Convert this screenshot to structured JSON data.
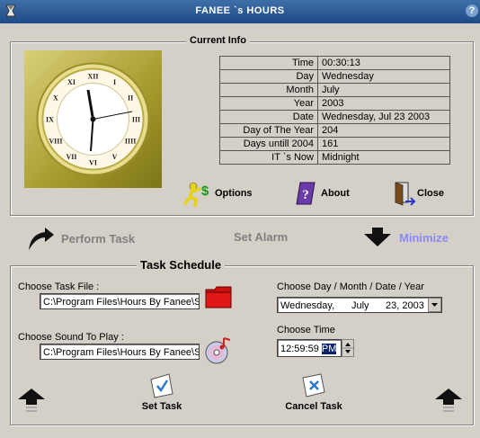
{
  "window": {
    "title": "FANEE `s HOURS",
    "help_label": "?"
  },
  "current_info": {
    "legend": "Current Info",
    "rows": [
      {
        "label": "Time",
        "value": "00:30:13"
      },
      {
        "label": "Day",
        "value": "Wednesday"
      },
      {
        "label": "Month",
        "value": "July"
      },
      {
        "label": "Year",
        "value": "2003"
      },
      {
        "label": "Date",
        "value": "Wednesday, Jul 23 2003"
      },
      {
        "label": "Day of The Year",
        "value": "204"
      },
      {
        "label": "Days untill  2004",
        "value": "161"
      },
      {
        "label": "IT `s Now",
        "value": "Midnight"
      }
    ],
    "clock_numerals": [
      "XII",
      "I",
      "II",
      "III",
      "IIII",
      "V",
      "VI",
      "VII",
      "VIII",
      "IX",
      "X",
      "XI"
    ],
    "buttons": {
      "options": "Options",
      "about": "About",
      "close": "Close"
    }
  },
  "actions": {
    "perform_task": "Perform Task",
    "set_alarm": "Set Alarm",
    "minimize": "Minimize"
  },
  "task_schedule": {
    "legend": "Task Schedule",
    "task_file_label": "Choose Task File :",
    "task_file_value": "C:\\Program Files\\Hours By Fanee\\St",
    "sound_label": "Choose Sound To Play :",
    "sound_value": "C:\\Program Files\\Hours By Fanee\\St",
    "date_label": "Choose Day / Month / Date / Year",
    "date_day": "Wednesday,",
    "date_month": "July",
    "date_rest": "23, 2003",
    "time_label": "Choose Time",
    "time_value": "12:59:59",
    "time_ampm": "PM",
    "set_task": "Set Task",
    "cancel_task": "Cancel Task"
  },
  "colors": {
    "accent": "#1d4a86",
    "minimize": "#8a8af0",
    "disabled": "#808080",
    "folder": "#cc1111"
  }
}
